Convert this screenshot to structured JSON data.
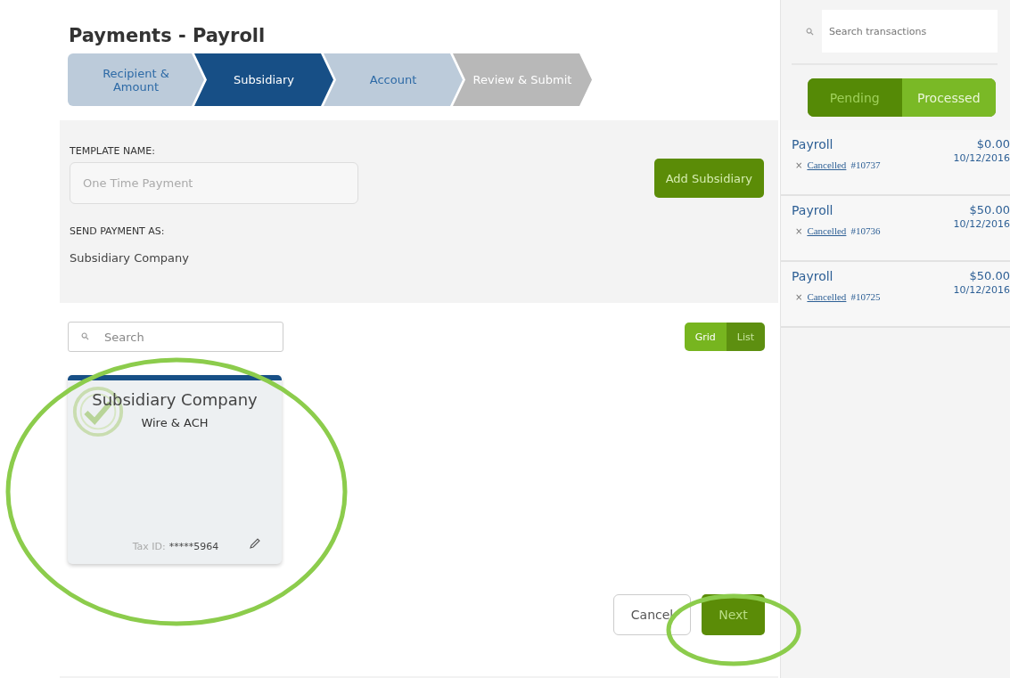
{
  "page_title": "Payments - Payroll",
  "steps": [
    {
      "label": "Recipient & Amount",
      "selected": false,
      "disabled": false
    },
    {
      "label": "Subsidiary",
      "selected": true,
      "disabled": false
    },
    {
      "label": "Account",
      "selected": false,
      "disabled": false
    },
    {
      "label": "Review & Submit",
      "selected": false,
      "disabled": true
    }
  ],
  "template": {
    "label": "TEMPLATE NAME:",
    "placeholder": "One Time Payment"
  },
  "add_button": "Add Subsidiary",
  "send_as": {
    "label": "SEND PAYMENT AS:",
    "value": "Subsidiary Company"
  },
  "search": {
    "placeholder": "Search"
  },
  "view_toggle": [
    {
      "label": "Grid",
      "selected": true
    },
    {
      "label": "List",
      "selected": false
    }
  ],
  "cards": [
    {
      "name": "Subsidiary Company",
      "method": "Wire & ACH",
      "tax_label": "Tax ID:",
      "tax_value": "*****5964",
      "checked": true
    }
  ],
  "buttons": {
    "cancel": "Cancel",
    "next": "Next"
  },
  "sidebar": {
    "search": {
      "placeholder": "Search transactions"
    },
    "filter": [
      {
        "label": "Pending",
        "selected": false
      },
      {
        "label": "Processed",
        "selected": true
      }
    ],
    "transactions": [
      {
        "title": "Payroll",
        "amount": "$0.00",
        "date": "10/12/2016",
        "icon": "×",
        "status": "Cancelled",
        "number": "#10737"
      },
      {
        "title": "Payroll",
        "amount": "$50.00",
        "date": "10/12/2016",
        "icon": "×",
        "status": "Cancelled",
        "number": "#10736"
      },
      {
        "title": "Payroll",
        "amount": "$50.00",
        "date": "10/12/2016",
        "icon": "×",
        "status": "Cancelled",
        "number": "#10725"
      }
    ]
  }
}
